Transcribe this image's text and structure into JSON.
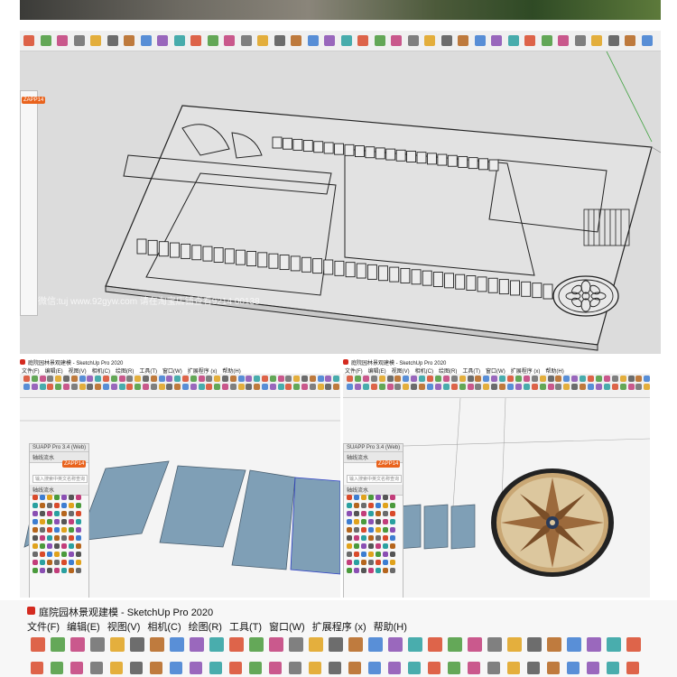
{
  "colors": {
    "toolbar": "#f0f0f0",
    "viewport": "#dcdcdc",
    "accent": "#e9631d",
    "slab": "#7f9fb6",
    "selection": "#2e3fc6"
  },
  "top_panel": {
    "watermark": "微信:tuj www.92gyw.com 请在淘宝店铺查看9214 00138"
  },
  "sidebar_top": {
    "badge": "ZAPP14"
  },
  "left_panel": {
    "window_title": "庭院园林景观建模 - SketchUp Pro 2020",
    "menu": [
      "文件(F)",
      "编辑(E)",
      "视图(V)",
      "相机(C)",
      "绘图(R)",
      "工具(T)",
      "窗口(W)",
      "扩展程序 (x)",
      "帮助(H)"
    ],
    "plugin_title": "SUAPP Pro 3.4 (Web)",
    "plugin_subtitle": "轴线流水",
    "badge": "ZAPP14",
    "search_placeholder": "输入搜索中英文名称查询",
    "section": "轴线流水"
  },
  "right_panel": {
    "window_title": "庭院园林景观建模 - SketchUp Pro 2020",
    "menu": [
      "文件(F)",
      "编辑(E)",
      "视图(V)",
      "相机(C)",
      "绘图(R)",
      "工具(T)",
      "窗口(W)",
      "扩展程序 (x)",
      "帮助(H)"
    ],
    "plugin_title": "SUAPP Pro 3.4 (Web)",
    "plugin_subtitle": "轴线流水",
    "badge": "ZAPP14",
    "search_placeholder": "输入搜索中英文名称查询",
    "section": "轴线流水"
  },
  "bottom_panel": {
    "window_title": "庭院园林景观建模 - SketchUp Pro 2020",
    "menu": [
      "文件(F)",
      "编辑(E)",
      "视图(V)",
      "相机(C)",
      "绘图(R)",
      "工具(T)",
      "窗口(W)",
      "扩展程序 (x)",
      "帮助(H)"
    ]
  }
}
